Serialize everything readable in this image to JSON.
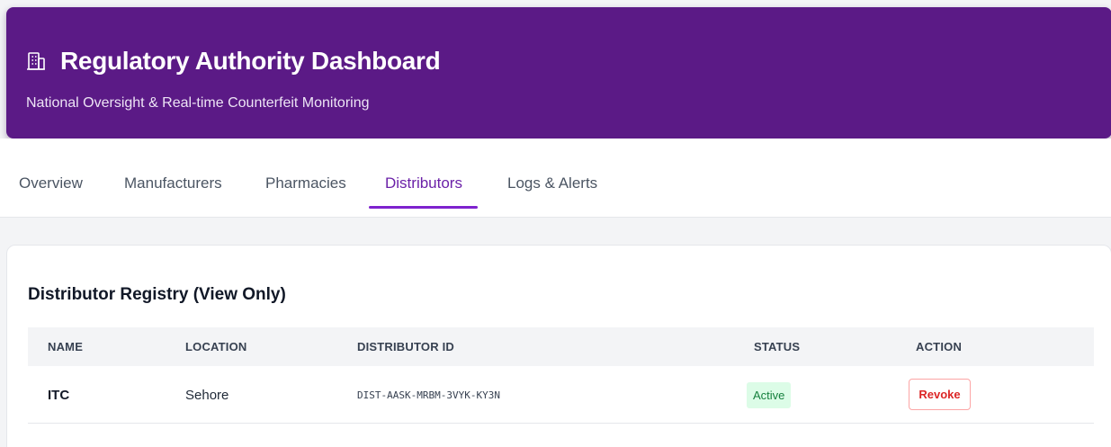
{
  "header": {
    "icon": "building-icon",
    "title": "Regulatory Authority Dashboard",
    "subtitle": "National Oversight & Real-time Counterfeit Monitoring"
  },
  "tabs": [
    {
      "label": "Overview",
      "active": false
    },
    {
      "label": "Manufacturers",
      "active": false
    },
    {
      "label": "Pharmacies",
      "active": false
    },
    {
      "label": "Distributors",
      "active": true
    },
    {
      "label": "Logs & Alerts",
      "active": false
    }
  ],
  "registry": {
    "title": "Distributor Registry (View Only)",
    "columns": [
      "NAME",
      "LOCATION",
      "DISTRIBUTOR ID",
      "STATUS",
      "ACTION"
    ],
    "rows": [
      {
        "name": "ITC",
        "location": "Sehore",
        "distributor_id": "DIST-AASK-MRBM-3VYK-KY3N",
        "status": "Active",
        "action": "Revoke"
      }
    ]
  },
  "colors": {
    "header_bg": "#5b1a86",
    "active_tab": "#6b21a8",
    "status_active_bg": "#dcfce7",
    "status_active_text": "#15803d",
    "revoke_text": "#dc2626"
  }
}
